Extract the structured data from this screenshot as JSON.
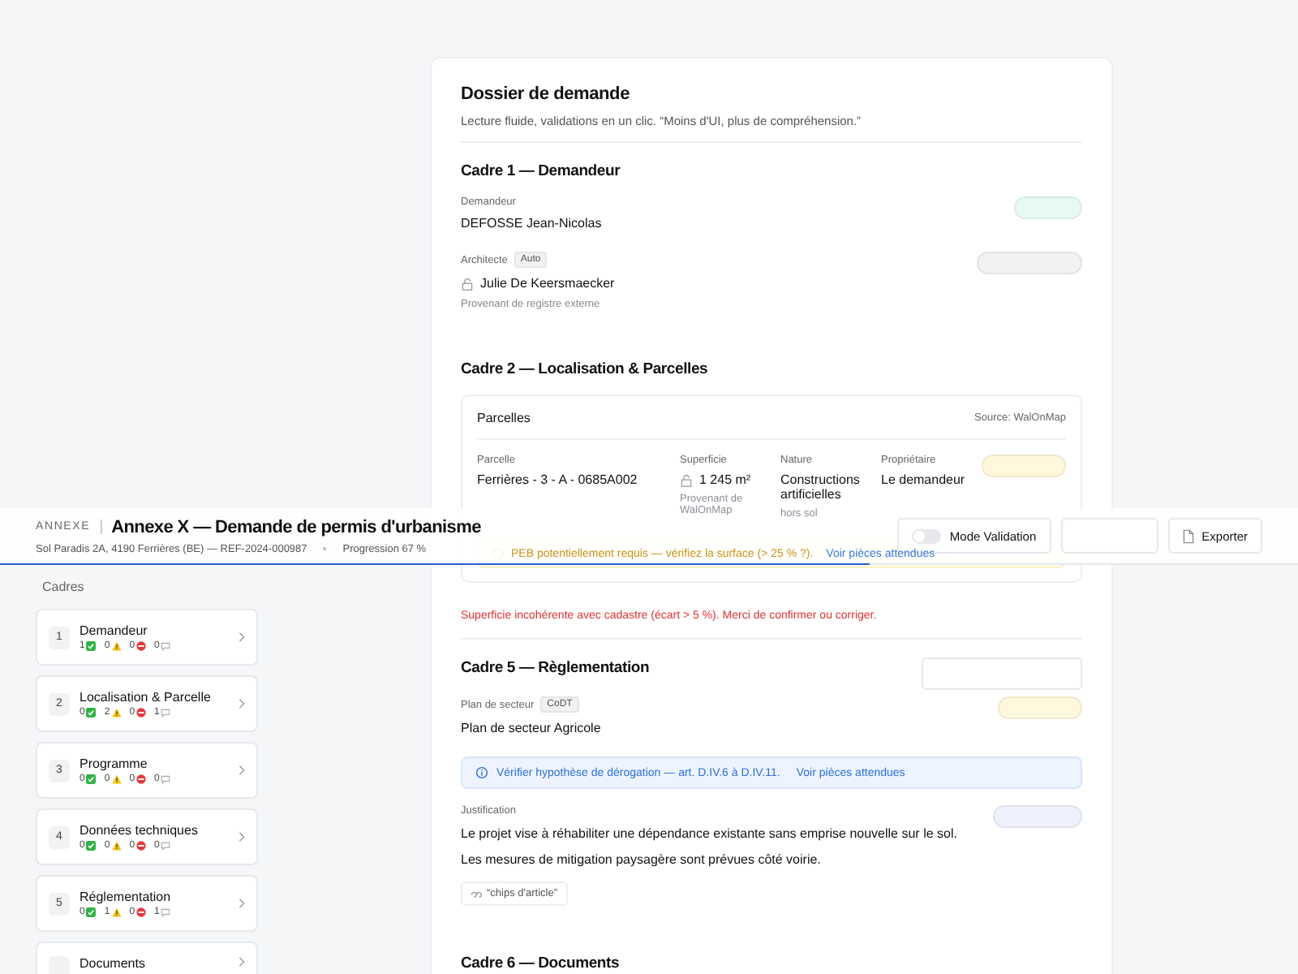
{
  "header": {
    "eyebrow": "ANNEXE",
    "title": "Annexe X — Demande de permis d'urbanisme",
    "address": "Sol Paradis 2A, 4190 Ferrières (BE) — REF-2024-000987",
    "progress_label": "Progression 67 %",
    "level": 0.67,
    "toggle": {
      "label": "Mode Validation",
      "on": false
    },
    "export_label": "Exporter"
  },
  "sidebar": {
    "title": "Cadres",
    "items": [
      {
        "number": "1",
        "title": "Demandeur",
        "ok": "1",
        "warning": "0",
        "error": "0",
        "comment": "0"
      },
      {
        "number": "2",
        "title": "Localisation & Parcelle",
        "ok": "0",
        "warning": "2",
        "error": "0",
        "comment": "1"
      },
      {
        "number": "3",
        "title": "Programme",
        "ok": "0",
        "warning": "0",
        "error": "0",
        "comment": "0"
      },
      {
        "number": "4",
        "title": "Données techniques",
        "ok": "0",
        "warning": "0",
        "error": "0",
        "comment": "0"
      },
      {
        "number": "5",
        "title": "Réglementation",
        "ok": "0",
        "warning": "1",
        "error": "0",
        "comment": "1"
      },
      {
        "title": "Documents"
      }
    ]
  },
  "dossier": {
    "title": "Dossier de demande",
    "subtitle": "Lecture fluide, validations en un clic. “Moins d'UI, plus de compréhension.”",
    "cadre1": {
      "title": "Cadre 1 — Demandeur",
      "demandeur": {
        "label": "Demandeur",
        "value": "DEFOSSE Jean-Nicolas",
        "color": "#e8fbf2"
      },
      "architecte": {
        "label": "Architecte",
        "badge": "Auto",
        "value": "Julie De Keersmaecker",
        "hint": "Provenant de registre externe",
        "color": "#f1f2f4"
      }
    },
    "cadre2": {
      "title": "Cadre 2 — Localisation & Parcelles",
      "parcelles": {
        "title": "Parcelles",
        "source": "Source: WalOnMap",
        "row": {
          "parcelle_label": "Parcelle",
          "parcelle": "Ferrières - 3 - A - 0685A002",
          "superficie_label": "Superficie",
          "superficie": "1 245 m²",
          "superficie_hint": "Provenant de WalOnMap",
          "nature_label": "Nature",
          "nature": "Constructions artificielles",
          "nature_hint": "hors sol",
          "proprietaire_label": "Propriétaire",
          "proprietaire": "Le demandeur",
          "color": "#fff8dc"
        },
        "alert": {
          "text": "PEB potentiellement requis — vérifiez la surface (> 25 % ?).",
          "link": "Voir pièces attendues"
        }
      },
      "error": "Superficie incohérente avec cadastre (écart > 5 %). Merci de confirmer ou corriger."
    },
    "cadre5": {
      "title": "Cadre 5 — Règlementation",
      "plan": {
        "label": "Plan de secteur",
        "badge": "CoDT",
        "value": "Plan de secteur Agricole",
        "color": "#fff8dc"
      },
      "info": {
        "text": "Vérifier hypothèse de dérogation — art. D.IV.6 à D.IV.11.",
        "link": "Voir pièces attendues"
      },
      "justification": {
        "label": "Justification",
        "lines": [
          "Le projet vise à réhabiliter une dépendance existante sans emprise nouvelle sur le sol.",
          "Les mesures de mitigation paysagère sont prévues côté voirie."
        ],
        "chip": "“chips d'article”",
        "color": "#eef1fc"
      }
    },
    "cadre6": {
      "title": "Cadre 6 — Documents"
    }
  }
}
